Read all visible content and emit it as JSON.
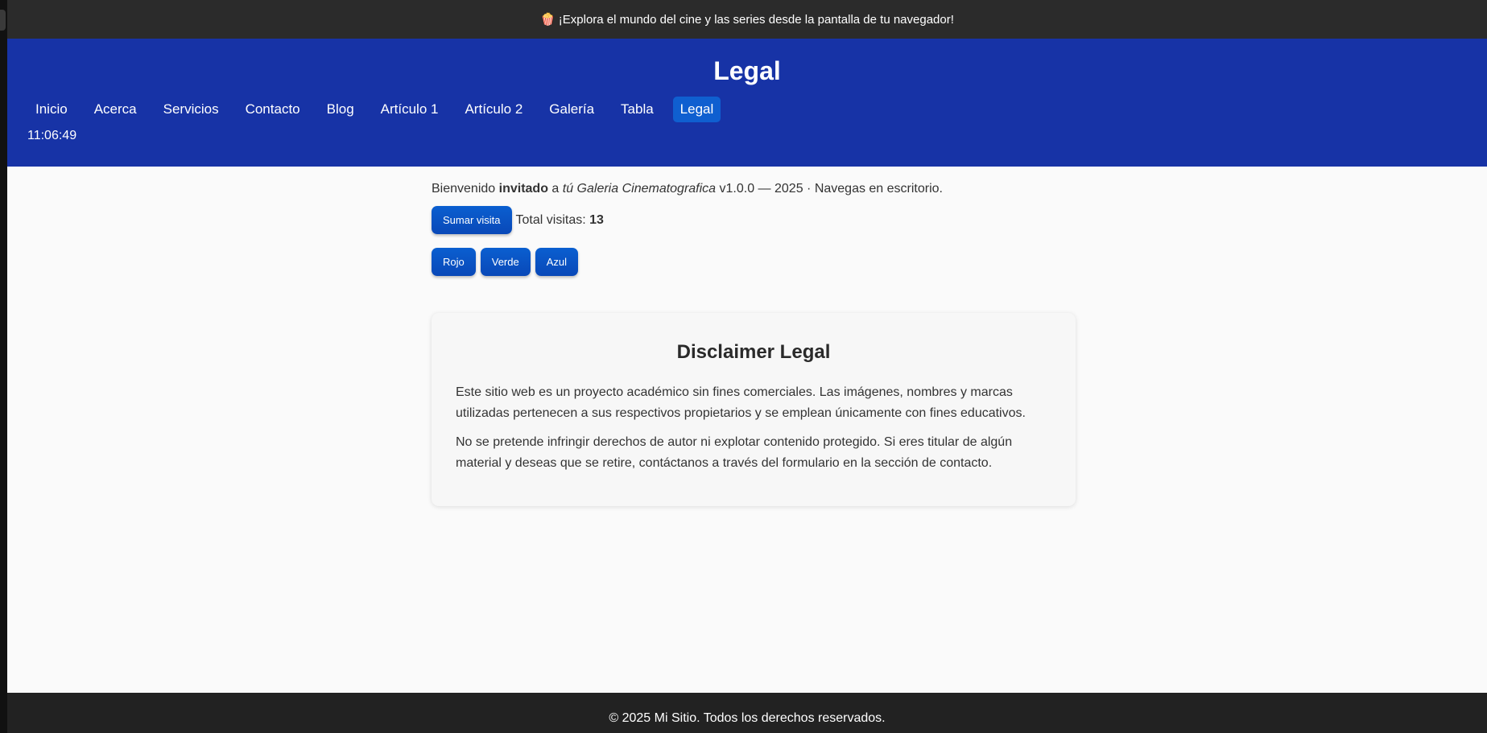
{
  "announcement": {
    "icon": "popcorn-icon",
    "emoji": "🍿",
    "text": "¡Explora el mundo del cine y las series desde la pantalla de tu navegador!"
  },
  "header": {
    "title": "Legal",
    "clock": "11:06:49",
    "nav": [
      {
        "label": "Inicio",
        "active": false
      },
      {
        "label": "Acerca",
        "active": false
      },
      {
        "label": "Servicios",
        "active": false
      },
      {
        "label": "Contacto",
        "active": false
      },
      {
        "label": "Blog",
        "active": false
      },
      {
        "label": "Artículo 1",
        "active": false
      },
      {
        "label": "Artículo 2",
        "active": false
      },
      {
        "label": "Galería",
        "active": false
      },
      {
        "label": "Tabla",
        "active": false
      },
      {
        "label": "Legal",
        "active": true
      }
    ]
  },
  "welcome": {
    "prefix": "Bienvenido ",
    "user": "invitado",
    "middle": " a ",
    "site": "tú Galeria Cinematografica",
    "suffix": " v1.0.0 — 2025 · Navegas en escritorio."
  },
  "visits": {
    "button_label": "Sumar visita",
    "label": "Total visitas: ",
    "count": "13"
  },
  "color_buttons": [
    "Rojo",
    "Verde",
    "Azul"
  ],
  "disclaimer": {
    "title": "Disclaimer Legal",
    "paragraph1": "Este sitio web es un proyecto académico sin fines comerciales. Las imágenes, nombres y marcas utilizadas pertenecen a sus respectivos propietarios y se emplean únicamente con fines educativos.",
    "paragraph2": "No se pretende infringir derechos de autor ni explotar contenido protegido. Si eres titular de algún material y deseas que se retire, contáctanos a través del formulario en la sección de contacto."
  },
  "footer": {
    "text": "© 2025 Mi Sitio. Todos los derechos reservados."
  },
  "colors": {
    "header_bg": "#1733a6",
    "nav_active": "#0f5fd0",
    "button_bg": "#0a5fd0",
    "topbar_bg": "#2b2b2b",
    "footer_bg": "#222222"
  }
}
